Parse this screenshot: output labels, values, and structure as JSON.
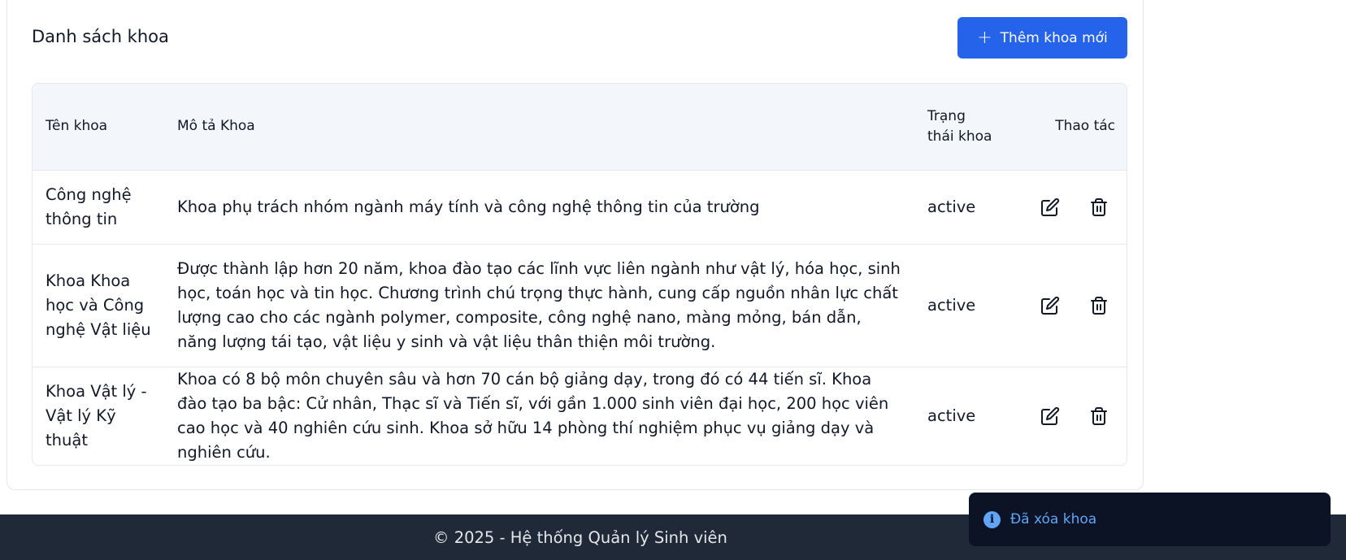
{
  "card": {
    "title": "Danh sách khoa",
    "add_button_label": "Thêm khoa mới",
    "add_button_icon": "plus-icon"
  },
  "table": {
    "headers": {
      "name": "Tên khoa",
      "description": "Mô tả Khoa",
      "status": "Trạng thái khoa",
      "actions": "Thao tác"
    },
    "rows": [
      {
        "name": "Công nghệ thông tin",
        "description": "Khoa phụ trách nhóm ngành máy tính và công nghệ thông tin của trường",
        "status": "active"
      },
      {
        "name": "Khoa Khoa học và Công nghệ Vật liệu",
        "description": "Được thành lập hơn 20 năm, khoa đào tạo các lĩnh vực liên ngành như vật lý, hóa học, sinh học, toán học và tin học. Chương trình chú trọng thực hành, cung cấp nguồn nhân lực chất lượng cao cho các ngành polymer, composite, công nghệ nano, màng mỏng, bán dẫn, năng lượng tái tạo, vật liệu y sinh và vật liệu thân thiện môi trường.",
        "status": "active"
      },
      {
        "name": "Khoa Vật lý - Vật lý Kỹ thuật",
        "description": "Khoa có 8 bộ môn chuyên sâu và hơn 70 cán bộ giảng dạy, trong đó có 44 tiến sĩ. Khoa đào tạo ba bậc: Cử nhân, Thạc sĩ và Tiến sĩ, với gần 1.000 sinh viên đại học, 200 học viên cao học và 40 nghiên cứu sinh. Khoa sở hữu 14 phòng thí nghiệm phục vụ giảng dạy và nghiên cứu.",
        "status": "active"
      }
    ],
    "row_action_icons": [
      "edit-icon",
      "trash-icon"
    ]
  },
  "footer": {
    "text": "© 2025 - Hệ thống Quản lý Sinh viên"
  },
  "toast": {
    "message": "Đã xóa khoa",
    "icon": "info-icon"
  },
  "colors": {
    "primary": "#2563eb",
    "header_bg": "#f3f6fa",
    "footer_bg": "#1f2937",
    "toast_bg": "#0b1324",
    "toast_text": "#60a5fa"
  }
}
